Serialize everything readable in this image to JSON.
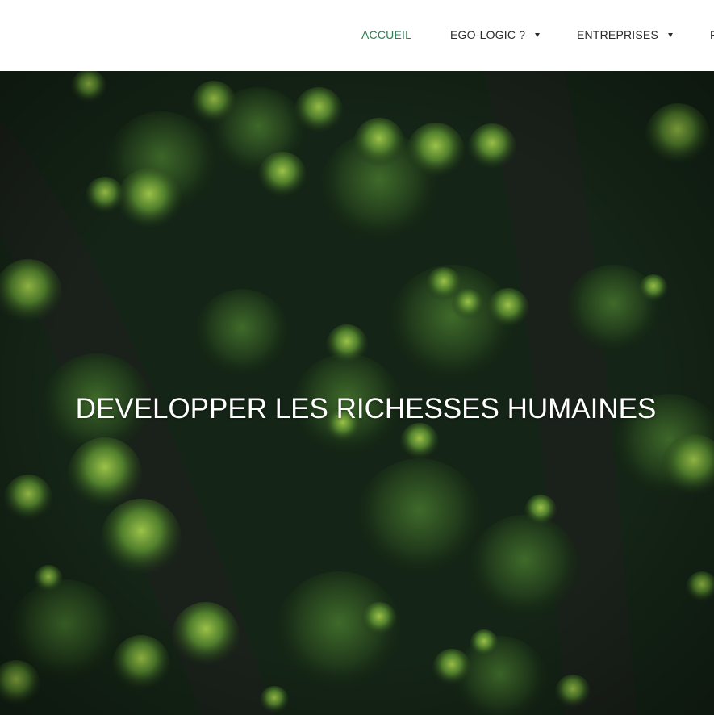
{
  "nav": {
    "items": [
      {
        "label": "ACCUEIL",
        "active": true,
        "has_dropdown": false
      },
      {
        "label": "EGO-LOGIC ?",
        "active": false,
        "has_dropdown": true
      },
      {
        "label": "ENTREPRISES",
        "active": false,
        "has_dropdown": true
      },
      {
        "label": "F",
        "active": false,
        "has_dropdown": false
      }
    ],
    "active_color": "#2e7d4f",
    "text_color": "#2b2b2b"
  },
  "hero": {
    "title": "DEVELOPPER LES RICHESSES HUMAINES",
    "background": "aerial-forest-image"
  }
}
